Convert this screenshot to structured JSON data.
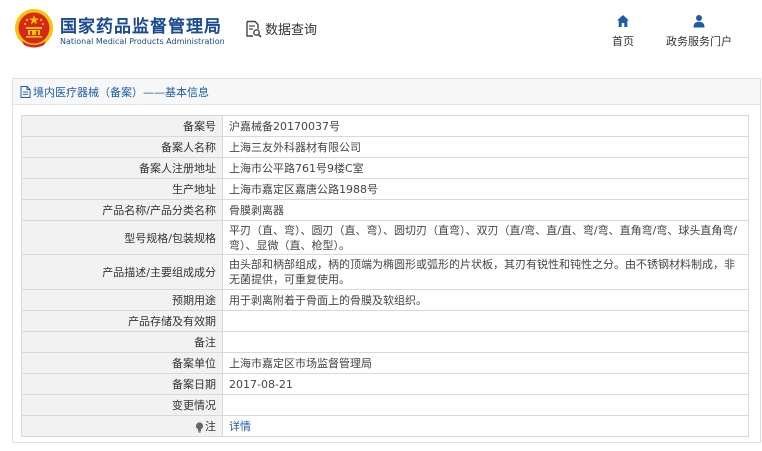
{
  "header": {
    "brand_cn": "国家药品监督管理局",
    "brand_en": "National Medical Products Administration",
    "data_query": "数据查询",
    "nav": [
      {
        "label": "首页",
        "icon": "home-icon"
      },
      {
        "label": "政务服务门户",
        "icon": "user-icon"
      }
    ]
  },
  "panel": {
    "title": "境内医疗器械（备案）——基本信息"
  },
  "record": {
    "rows": [
      {
        "key": "备案号",
        "value": "沪嘉械备20170037号"
      },
      {
        "key": "备案人名称",
        "value": "上海三友外科器材有限公司"
      },
      {
        "key": "备案人注册地址",
        "value": "上海市公平路761号9楼C室"
      },
      {
        "key": "生产地址",
        "value": "上海市嘉定区嘉唐公路1988号"
      },
      {
        "key": "产品名称/产品分类名称",
        "value": "骨膜剥离器"
      },
      {
        "key": "型号规格/包装规格",
        "value": "平刃（直、弯）、圆刃（直、弯）、圆切刃（直弯）、双刃（直/弯、直/直、弯/弯、直角弯/弯、球头直角弯/弯）、显微（直、枪型）。"
      },
      {
        "key": "产品描述/主要组成成分",
        "value": "由头部和柄部组成，柄的顶端为椭圆形或弧形的片状板，其刃有锐性和钝性之分。由不锈钢材料制成，非无菌提供，可重复使用。"
      },
      {
        "key": "预期用途",
        "value": "用于剥离附着于骨面上的骨膜及软组织。"
      },
      {
        "key": "产品存储及有效期",
        "value": ""
      },
      {
        "key": "备注",
        "value": ""
      },
      {
        "key": "备案单位",
        "value": "上海市嘉定区市场监督管理局"
      },
      {
        "key": "备案日期",
        "value": "2017-08-21"
      },
      {
        "key": "变更情况",
        "value": ""
      },
      {
        "key": "注",
        "value": "详情",
        "icon": "lightbulb-icon"
      }
    ]
  },
  "colors": {
    "brand_blue": "#1a4a8f",
    "link_blue": "#1d5ca8",
    "emblem_red": "#d7261c",
    "emblem_gold": "#f5c400"
  }
}
